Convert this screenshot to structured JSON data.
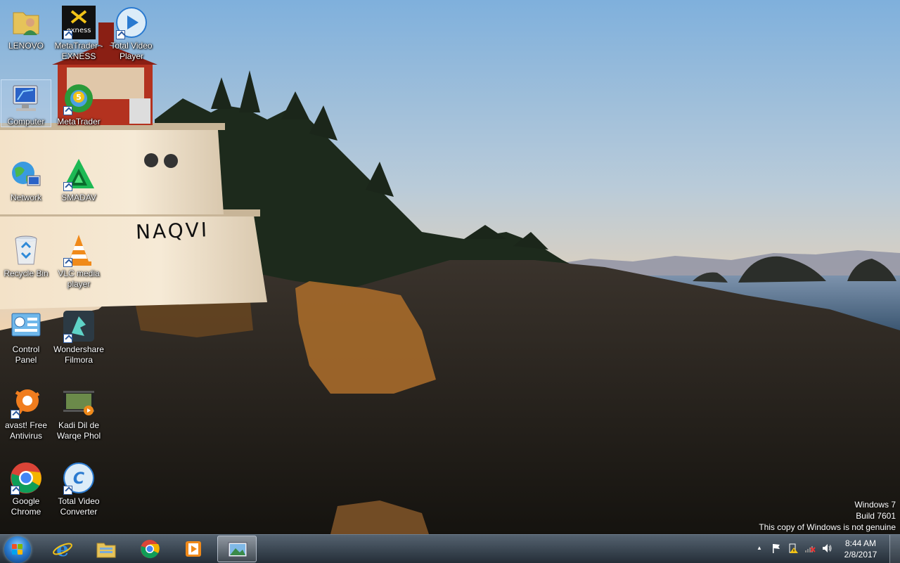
{
  "desktop": {
    "icons": [
      {
        "label": "LENOVO",
        "icon": "user-folder-icon"
      },
      {
        "label": "MetaTrader - EXNESS",
        "icon": "exness-icon"
      },
      {
        "label": "Total Video Player",
        "icon": "play-icon"
      },
      {
        "label": "Computer",
        "icon": "computer-icon"
      },
      {
        "label": "MetaTrader",
        "icon": "metatrader-icon"
      },
      {
        "label": "Network",
        "icon": "network-icon"
      },
      {
        "label": "SMADAV",
        "icon": "smadav-icon"
      },
      {
        "label": "Recycle Bin",
        "icon": "recycle-bin-icon"
      },
      {
        "label": "VLC media player",
        "icon": "vlc-cone-icon"
      },
      {
        "label": "Control Panel",
        "icon": "control-panel-icon"
      },
      {
        "label": "Wondershare Filmora",
        "icon": "filmora-icon"
      },
      {
        "label": "avast! Free Antivirus",
        "icon": "avast-icon"
      },
      {
        "label": "Kadi Dil de Warqe Phol",
        "icon": "video-file-icon"
      },
      {
        "label": "Google Chrome",
        "icon": "chrome-icon"
      },
      {
        "label": "Total Video Converter",
        "icon": "converter-icon"
      }
    ],
    "wallpaper_text": "NAQVI"
  },
  "watermark": {
    "line1": "Windows 7",
    "line2": "Build 7601",
    "line3": "This copy of Windows is not genuine"
  },
  "taskbar": {
    "pinned": [
      {
        "name": "internet-explorer",
        "icon": "ie-icon"
      },
      {
        "name": "windows-explorer",
        "icon": "folder-icon"
      },
      {
        "name": "google-chrome",
        "icon": "chrome-icon"
      },
      {
        "name": "media-player",
        "icon": "media-player-icon"
      },
      {
        "name": "photo-viewer",
        "icon": "photo-viewer-icon",
        "active": true
      }
    ],
    "tray": {
      "time": "8:44 AM",
      "date": "2/8/2017",
      "up_arrow": "▲"
    }
  },
  "colors": {
    "sky_top": "#8db4d8",
    "sky_bottom": "#f4c89a",
    "lighthouse_red": "#b3321f"
  }
}
